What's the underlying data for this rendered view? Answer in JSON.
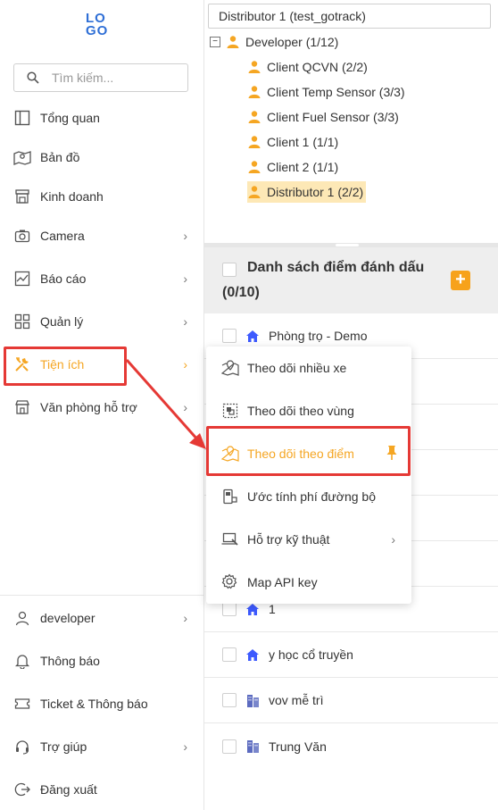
{
  "logo": {
    "line1": "LO",
    "line2": "GO"
  },
  "search": {
    "placeholder": "Tìm kiếm..."
  },
  "nav_top": [
    {
      "label": "Tổng quan",
      "icon": "dashboard-icon"
    },
    {
      "label": "Bản đồ",
      "icon": "map-icon"
    },
    {
      "label": "Kinh doanh",
      "icon": "store-icon"
    },
    {
      "label": "Camera",
      "icon": "camera-icon"
    },
    {
      "label": "Báo cáo",
      "icon": "chart-icon"
    },
    {
      "label": "Quản lý",
      "icon": "grid-icon"
    },
    {
      "label": "Tiện ích",
      "icon": "tools-icon"
    },
    {
      "label": "Văn phòng hỗ trợ",
      "icon": "shop-icon"
    }
  ],
  "nav_bottom": [
    {
      "label": "developer",
      "icon": "user-icon"
    },
    {
      "label": "Thông báo",
      "icon": "bell-icon"
    },
    {
      "label": "Ticket & Thông báo",
      "icon": "ticket-icon"
    },
    {
      "label": "Trợ giúp",
      "icon": "headset-icon"
    },
    {
      "label": "Đăng xuất",
      "icon": "logout-icon"
    }
  ],
  "distributor": {
    "value": "Distributor 1 (test_gotrack)"
  },
  "tree": {
    "toggle": "−",
    "root": "Developer (1/12)",
    "children": [
      "Client QCVN (2/2)",
      "Client Temp Sensor (3/3)",
      "Client Fuel Sensor (3/3)",
      "Client 1 (1/1)",
      "Client 2 (1/1)",
      "Distributor 1 (2/2)"
    ]
  },
  "list": {
    "title": "Danh sách điểm đánh dấu",
    "count": "(0/10)",
    "add": "+",
    "rows": [
      {
        "label": "Phòng trọ - Demo",
        "icon": "home-icon"
      },
      {
        "label": "1",
        "icon": "home-icon"
      },
      {
        "label": "y học cổ truyền",
        "icon": "home-icon"
      },
      {
        "label": "vov mễ trì",
        "icon": "building-icon"
      },
      {
        "label": "Trung Văn",
        "icon": "building-icon"
      }
    ]
  },
  "popup": [
    {
      "label": "Theo dõi nhiều xe"
    },
    {
      "label": "Theo dõi theo vùng"
    },
    {
      "label": "Theo dõi theo điểm"
    },
    {
      "label": "Ước tính phí đường bộ"
    },
    {
      "label": "Hỗ trợ kỹ thuật"
    },
    {
      "label": "Map API key"
    }
  ],
  "colors": {
    "accent": "#f5a623",
    "highlight": "#e53935",
    "brand": "#2f6fd6",
    "icon_blue": "#3d5afe"
  }
}
